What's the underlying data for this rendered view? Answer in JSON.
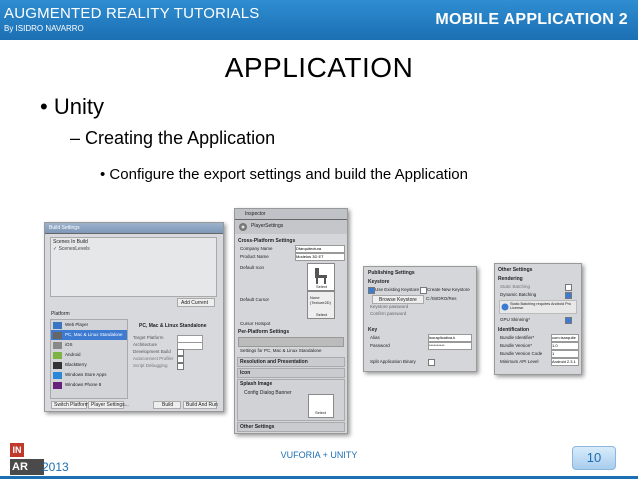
{
  "header": {
    "title": "AUGMENTED REALITY TUTORIALS",
    "author": "By ISIDRO NAVARRO",
    "section": "MOBILE APPLICATION 2"
  },
  "slide": {
    "title": "APPLICATION",
    "bullet1": "Unity",
    "bullet2": "Creating the Application",
    "bullet3": "Configure the export settings and build the Application"
  },
  "shot1": {
    "title": "Build Settings",
    "scenes_header": "Scenes In Build",
    "add_current": "Add Current",
    "platform_label": "Platform",
    "platforms": [
      "Web Player",
      "PC, Mac & Linux Standalone",
      "iOS",
      "Android",
      "BlackBerry",
      "Windows Store Apps",
      "Windows Phone 8"
    ],
    "selected_platform": "PC, Mac & Linux Standalone",
    "options": [
      "Target Platform",
      "Architecture",
      "Development Build",
      "Autoconnect Profiler",
      "Script Debugging"
    ],
    "switch_platform": "Switch Platform",
    "player_settings": "Player Settings...",
    "build": "Build",
    "build_and_run": "Build And Run"
  },
  "shot2": {
    "title": "Inspector",
    "subtitle": "PlayerSettings",
    "cross_platform": "Cross-Platform Settings",
    "company_name_label": "Company Name",
    "company_name": "Dfarquitectura",
    "product_name_label": "Product Name",
    "product_name": "Modelos 3D ET",
    "default_icon": "Default Icon",
    "default_cursor": "Default Cursor",
    "cursor_hotspot": "Cursor Hotspot",
    "per_platform": "Per-Platform Settings",
    "settings_for": "Settings for PC, Mac & Linux Standalone",
    "resolution": "Resolution and Presentation",
    "icon": "Icon",
    "splash": "Splash Image",
    "config_banner": "Config Dialog Banner",
    "other": "Other Settings",
    "select": "Select",
    "none_label": "None (Texture2D)"
  },
  "shot3": {
    "title": "Publishing Settings",
    "keystore": "Keystore",
    "use_existing": "Use Existing Keystore",
    "create_new": "Create New Keystore",
    "browse": "Browse Keystore",
    "path": "C:/ISIDRO/Res",
    "keystore_password": "Keystore password",
    "confirm_password": "Confirm password",
    "key": "Key",
    "alias_label": "Alias",
    "alias": "isoraplicativa.k",
    "password_label": "Password",
    "password": "**********",
    "split": "Split Application Binary"
  },
  "shot4": {
    "title": "Other Settings",
    "rendering": "Rendering",
    "static_batching": "Static Batching",
    "dynamic_batching": "Dynamic Batching",
    "note": "Static Batching requires Android Pro License.",
    "gpu_skinning": "GPU Skinning*",
    "identification": "Identification",
    "bundle_id_label": "Bundle Identifier*",
    "bundle_id": "com.isarquite",
    "bundle_version_label": "Bundle Version*",
    "bundle_version": "1.0",
    "bundle_code_label": "Bundle Version Code",
    "bundle_code": "1",
    "min_api_label": "Minimum API Level",
    "min_api": "Android 2.3.1"
  },
  "footer": {
    "logo_top": "IN",
    "logo_bottom": "AR",
    "year": "2013",
    "center": "VUFORIA + UNITY",
    "page": "10"
  },
  "colors": {
    "brand": "#1c6fb3",
    "logo_red": "#c0392b",
    "select_blue": "#3d7bd2"
  }
}
